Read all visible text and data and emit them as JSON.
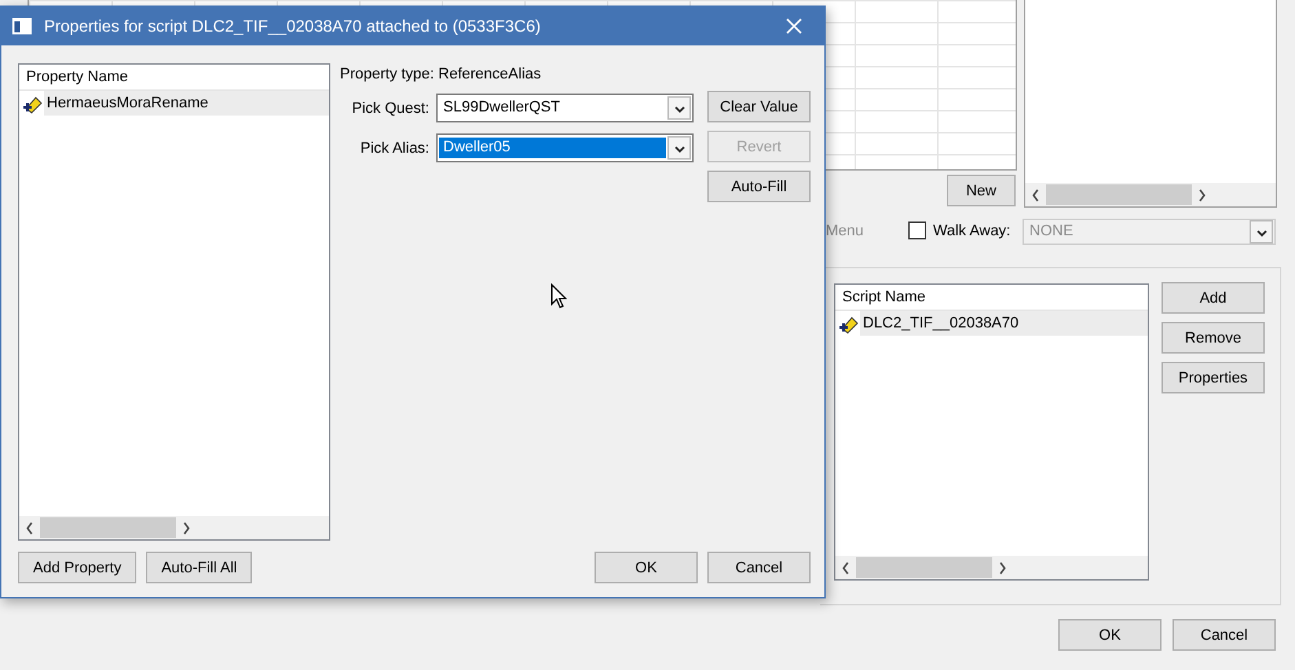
{
  "background_window": {
    "new_button": "New",
    "menu_label": "Menu",
    "walk_away": {
      "label": "Walk Away:",
      "checked": false
    },
    "walk_away_select": {
      "value": "NONE",
      "disabled": true
    },
    "scripts": {
      "column": "Script Name",
      "rows": [
        {
          "name": "DLC2_TIF__02038A70",
          "selected": true
        }
      ]
    },
    "script_buttons": [
      "Add",
      "Remove",
      "Properties"
    ],
    "buttons": [
      "OK",
      "Cancel"
    ]
  },
  "dialog": {
    "title": "Properties for script DLC2_TIF__02038A70 attached to  (0533F3C6)",
    "properties": {
      "column": "Property Name",
      "items": [
        {
          "name": "HermaeusMoraRename",
          "selected": true
        }
      ]
    },
    "property_type": "Property type: ReferenceAlias",
    "fields": [
      {
        "label": "Pick Quest:",
        "value": "SL99DwellerQST",
        "selected": false
      },
      {
        "label": "Pick Alias:",
        "value": "Dweller05",
        "selected": true
      }
    ],
    "side_buttons": [
      {
        "label": "Clear Value",
        "disabled": false
      },
      {
        "label": "Revert",
        "disabled": true
      },
      {
        "label": "Auto-Fill",
        "disabled": false
      }
    ],
    "left_buttons": [
      "Add Property",
      "Auto-Fill All"
    ],
    "buttons": [
      "OK",
      "Cancel"
    ]
  }
}
